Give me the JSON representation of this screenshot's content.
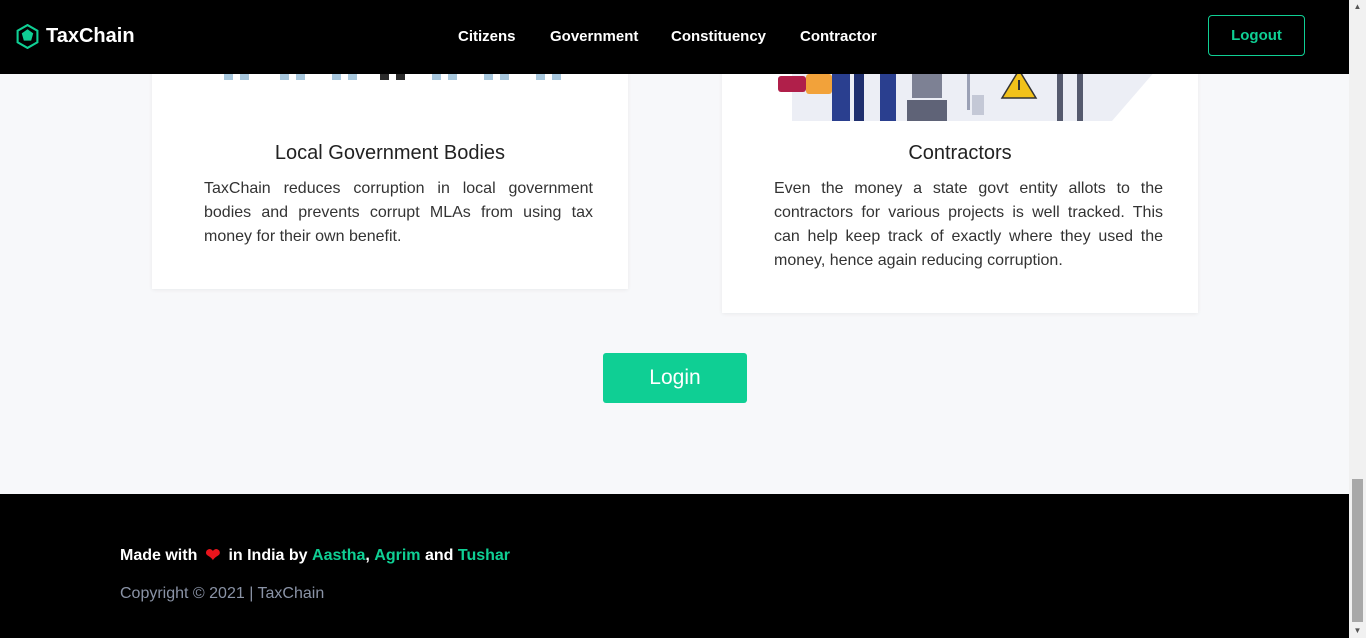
{
  "navbar": {
    "brand": "TaxChain",
    "links": [
      "Citizens",
      "Government",
      "Constituency",
      "Contractor"
    ],
    "logout_label": "Logout"
  },
  "cards": [
    {
      "title": "Local Government Bodies",
      "text": "TaxChain reduces corruption in local government bodies and prevents corrupt MLAs from using tax money for their own benefit."
    },
    {
      "title": "Contractors",
      "text": "Even the money a state govt entity allots to the contractors for various projects is well tracked. This can help keep track of exactly where they used the money, hence again reducing corruption."
    }
  ],
  "login_label": "Login",
  "footer": {
    "made_with": "Made with",
    "in_india_by": "in India by",
    "authors": [
      "Aastha",
      "Agrim",
      "Tushar"
    ],
    "separator": ",",
    "and": "and",
    "copyright": "Copyright © 2021 | TaxChain"
  },
  "colors": {
    "accent": "#0fcf94",
    "heart": "#e8141c",
    "navbar_bg": "#000000",
    "page_bg": "#f7f8fa"
  }
}
